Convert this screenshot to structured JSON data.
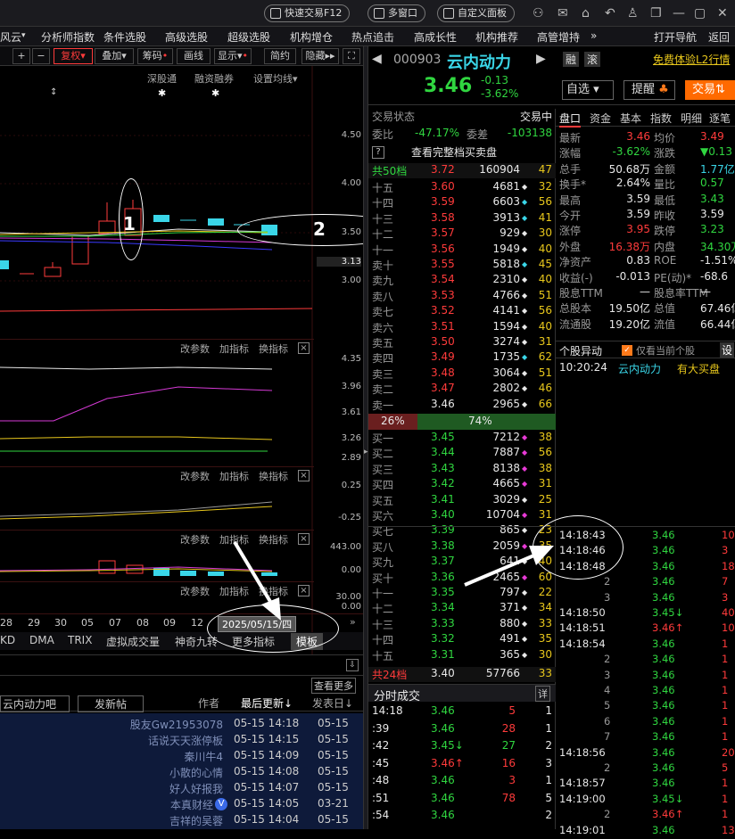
{
  "topbar": {
    "quick_trade": "快速交易F12",
    "multi_window": "多窗口",
    "custom_panel": "自定义面板"
  },
  "menu": [
    "风云",
    "分析师指数",
    "条件选股",
    "高级选股",
    "超级选股",
    "机构增仓",
    "热点追击",
    "高成长性",
    "机构推荐",
    "高管增持",
    "»",
    "打开导航",
    "返回"
  ],
  "chart_toolbar": {
    "plus": "+",
    "minus": "−",
    "adjust": "复权",
    "overlay": "叠加",
    "chips": "筹码",
    "draw": "画线",
    "display": "显示",
    "simple": "简约",
    "hide": "隐藏"
  },
  "chart_sub": {
    "sz_connect": "深股通",
    "margin": "融资融券",
    "settings": "设置均线"
  },
  "price_axis": [
    "4.50",
    "4.00",
    "3.50",
    "3.13",
    "3.00"
  ],
  "ind1_axis": [
    "4.35",
    "3.96",
    "3.61",
    "3.26",
    "2.89"
  ],
  "ind2_axis": [
    "0.25",
    "-0.25"
  ],
  "ind3_axis": [
    "443.00",
    "0.00"
  ],
  "ind4_axis": [
    "30.00",
    "0.00"
  ],
  "panel_btns": {
    "edit": "改参数",
    "add": "加指标",
    "swap": "换指标",
    "close": "×"
  },
  "xaxis": [
    "28",
    "29",
    "30",
    "05",
    "07",
    "08",
    "09",
    "12"
  ],
  "date_box": "2025/05/15/四",
  "indicator_tabs": [
    "KD",
    "DMA",
    "TRIX",
    "虚拟成交量",
    "神奇九转",
    "更多指标",
    "模板"
  ],
  "annotations": [
    "1",
    "2"
  ],
  "forum": {
    "board": "云内动力吧",
    "post": "发新帖",
    "author": "作者",
    "last": "最后更新↓",
    "posted": "发表日↓",
    "more": "查看更多",
    "rows": [
      [
        "股友Gw21953078",
        "05-15 14:18",
        "05-15"
      ],
      [
        "话说天天涨停板",
        "05-15 14:15",
        "05-15"
      ],
      [
        "秦川牛4",
        "05-15 14:09",
        "05-15"
      ],
      [
        "小散的心情",
        "05-15 14:08",
        "05-15"
      ],
      [
        "好人好报我",
        "05-15 14:07",
        "05-15"
      ],
      [
        "本真财经",
        "05-15 14:05",
        "03-21"
      ],
      [
        "吉祥的吴蓉",
        "05-15 14:04",
        "05-15"
      ]
    ]
  },
  "stock": {
    "code": "000903",
    "name": "云内动力",
    "tag1": "融",
    "tag2": "滚",
    "free_l2": "免费体验L2行情",
    "price": "3.46",
    "change": "-0.13",
    "pct": "-3.62%",
    "watch": "自选",
    "alert": "提醒",
    "trade": "交易"
  },
  "status": {
    "label": "交易状态",
    "value": "交易中",
    "wb_label": "委比",
    "wb": "-47.17%",
    "wc_label": "委差",
    "wc": "-103138",
    "full": "查看完整档买卖盘",
    "q": "?"
  },
  "sell_head": {
    "label": "共50档",
    "price": "3.72",
    "vol": "160904",
    "n": "47"
  },
  "asks": [
    [
      "十五",
      "3.60",
      "4681",
      "w",
      "32"
    ],
    [
      "十四",
      "3.59",
      "6603",
      "c",
      "56"
    ],
    [
      "十三",
      "3.58",
      "3913",
      "c",
      "41"
    ],
    [
      "十二",
      "3.57",
      "929",
      "w",
      "30"
    ],
    [
      "十一",
      "3.56",
      "1949",
      "w",
      "40"
    ],
    [
      "卖十",
      "3.55",
      "5818",
      "c",
      "45"
    ],
    [
      "卖九",
      "3.54",
      "2310",
      "w",
      "40"
    ],
    [
      "卖八",
      "3.53",
      "4766",
      "w",
      "51"
    ],
    [
      "卖七",
      "3.52",
      "4141",
      "w",
      "56"
    ],
    [
      "卖六",
      "3.51",
      "1594",
      "w",
      "40"
    ],
    [
      "卖五",
      "3.50",
      "3274",
      "w",
      "31"
    ],
    [
      "卖四",
      "3.49",
      "1735",
      "c",
      "62"
    ],
    [
      "卖三",
      "3.48",
      "3064",
      "w",
      "51"
    ],
    [
      "卖二",
      "3.47",
      "2802",
      "w",
      "46"
    ],
    [
      "卖一",
      "3.46",
      "2965",
      "w",
      "66"
    ]
  ],
  "ratio": {
    "left": "26%",
    "right": "74%"
  },
  "bids": [
    [
      "买一",
      "3.45",
      "7212",
      "m",
      "38"
    ],
    [
      "买二",
      "3.44",
      "7887",
      "m",
      "56"
    ],
    [
      "买三",
      "3.43",
      "8138",
      "m",
      "38"
    ],
    [
      "买四",
      "3.42",
      "4665",
      "m",
      "31"
    ],
    [
      "买五",
      "3.41",
      "3029",
      "w",
      "25"
    ],
    [
      "买六",
      "3.40",
      "10704",
      "m",
      "31"
    ],
    [
      "买七",
      "3.39",
      "865",
      "w",
      "23"
    ],
    [
      "买八",
      "3.38",
      "2059",
      "m",
      "35"
    ],
    [
      "买九",
      "3.37",
      "641",
      "w",
      "40"
    ],
    [
      "买十",
      "3.36",
      "2465",
      "m",
      "60"
    ],
    [
      "十一",
      "3.35",
      "797",
      "w",
      "22"
    ],
    [
      "十二",
      "3.34",
      "371",
      "w",
      "34"
    ],
    [
      "十三",
      "3.33",
      "880",
      "w",
      "33"
    ],
    [
      "十四",
      "3.32",
      "491",
      "w",
      "35"
    ],
    [
      "十五",
      "3.31",
      "365",
      "w",
      "30"
    ]
  ],
  "buy_foot": {
    "label": "共24档",
    "price": "3.40",
    "vol": "57766",
    "n": "33"
  },
  "minute_trades": {
    "title": "分时成交",
    "detail": "详",
    "rows": [
      [
        "14:18",
        "3.46",
        "5",
        "1"
      ],
      [
        ":39",
        "3.46",
        "28",
        "1"
      ],
      [
        ":42",
        "3.45↓",
        "27",
        "2"
      ],
      [
        ":45",
        "3.46↑",
        "16",
        "3"
      ],
      [
        ":48",
        "3.46",
        "3",
        "1"
      ],
      [
        ":51",
        "3.46",
        "78",
        "5"
      ],
      [
        ":54",
        "3.46",
        "",
        "2"
      ]
    ]
  },
  "quote_tabs": [
    "盘口",
    "资金",
    "基本",
    "指数",
    "明细",
    "逐笔"
  ],
  "quote": [
    [
      "最新",
      "3.46",
      "r",
      "均价",
      "3.49",
      "r"
    ],
    [
      "涨幅",
      "-3.62%",
      "g",
      "涨跌",
      "▼0.13",
      "g"
    ],
    [
      "总手",
      "50.68万",
      "w",
      "金额",
      "1.77亿",
      "c"
    ],
    [
      "换手*",
      "2.64%",
      "w",
      "量比",
      "0.57",
      "g"
    ],
    [
      "最高",
      "3.59",
      "w",
      "最低",
      "3.43",
      "g"
    ],
    [
      "今开",
      "3.59",
      "w",
      "昨收",
      "3.59",
      "w"
    ],
    [
      "涨停",
      "3.95",
      "r",
      "跌停",
      "3.23",
      "g"
    ],
    [
      "外盘",
      "16.38万",
      "r",
      "内盘",
      "34.30万",
      "g"
    ],
    [
      "净资产",
      "0.83",
      "w",
      "ROE",
      "-1.51%",
      "w"
    ],
    [
      "收益(-)",
      "-0.013",
      "w",
      "PE(动)*",
      "-68.6",
      "w"
    ],
    [
      "股息TTM",
      "—",
      "w",
      "股息率TTM",
      "—",
      "w"
    ],
    [
      "总股本",
      "19.50亿",
      "w",
      "总值",
      "67.46亿",
      "w"
    ],
    [
      "流通股",
      "19.20亿",
      "w",
      "流值",
      "66.44亿",
      "w"
    ]
  ],
  "movement": {
    "title": "个股异动",
    "only": "仅看当前个股",
    "set": "设",
    "time": "10:20:24",
    "name": "云内动力",
    "event": "有大买盘"
  },
  "ticks": [
    [
      "14:18:43",
      "3.46",
      "10"
    ],
    [
      "14:18:46",
      "3.46",
      "3"
    ],
    [
      "14:18:48",
      "3.46",
      "18"
    ],
    [
      "2",
      "3.46",
      "7"
    ],
    [
      "3",
      "3.46",
      "3"
    ],
    [
      "14:18:50",
      "3.45↓",
      "40"
    ],
    [
      "14:18:51",
      "3.46↑",
      "10"
    ],
    [
      "14:18:54",
      "3.46",
      "1"
    ],
    [
      "2",
      "3.46",
      "1"
    ],
    [
      "3",
      "3.46",
      "1"
    ],
    [
      "4",
      "3.46",
      "1"
    ],
    [
      "5",
      "3.46",
      "1"
    ],
    [
      "6",
      "3.46",
      "1"
    ],
    [
      "7",
      "3.46",
      "1"
    ],
    [
      "14:18:56",
      "3.46",
      "20"
    ],
    [
      "2",
      "3.46",
      "5"
    ],
    [
      "14:18:57",
      "3.46",
      "1"
    ],
    [
      "14:19:00",
      "3.45↓",
      "1"
    ],
    [
      "2",
      "3.46↑",
      "1"
    ],
    [
      "14:19:01",
      "3.46",
      "131"
    ]
  ]
}
